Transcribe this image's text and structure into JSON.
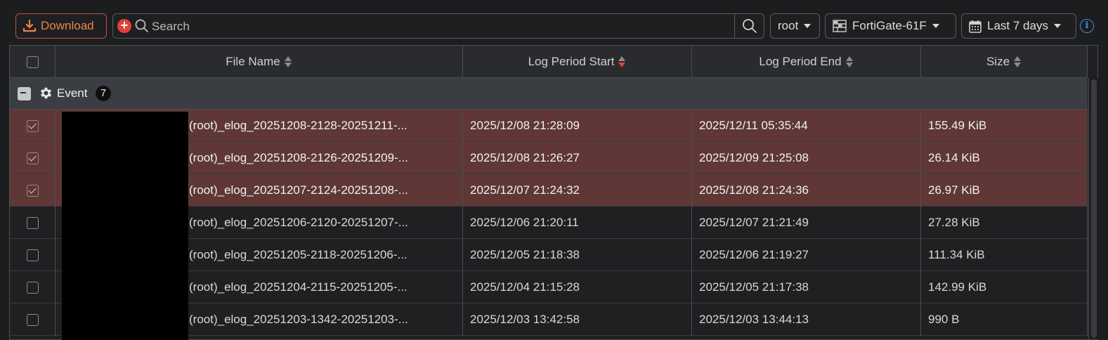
{
  "toolbar": {
    "download_label": "Download",
    "search_placeholder": "Search",
    "vdom": "root",
    "device": "FortiGate-61F",
    "time_range": "Last 7 days"
  },
  "columns": {
    "file_name": "File Name",
    "start": "Log Period Start",
    "end": "Log Period End",
    "size": "Size"
  },
  "group": {
    "name": "Event",
    "count": "7"
  },
  "rows": [
    {
      "file": "(root)_elog_20251208-2128-20251211-...",
      "start": "2025/12/08 21:28:09",
      "end": "2025/12/11 05:35:44",
      "size": "155.49 KiB",
      "checked": true
    },
    {
      "file": "(root)_elog_20251208-2126-20251209-...",
      "start": "2025/12/08 21:26:27",
      "end": "2025/12/09 21:25:08",
      "size": "26.14 KiB",
      "checked": true
    },
    {
      "file": "(root)_elog_20251207-2124-20251208-...",
      "start": "2025/12/07 21:24:32",
      "end": "2025/12/08 21:24:36",
      "size": "26.97 KiB",
      "checked": true
    },
    {
      "file": "(root)_elog_20251206-2120-20251207-...",
      "start": "2025/12/06 21:20:11",
      "end": "2025/12/07 21:21:49",
      "size": "27.28 KiB",
      "checked": false
    },
    {
      "file": "(root)_elog_20251205-2118-20251206-...",
      "start": "2025/12/05 21:18:38",
      "end": "2025/12/06 21:19:27",
      "size": "111.34 KiB",
      "checked": false
    },
    {
      "file": "(root)_elog_20251204-2115-20251205-...",
      "start": "2025/12/04 21:15:28",
      "end": "2025/12/05 21:17:38",
      "size": "142.99 KiB",
      "checked": false
    },
    {
      "file": "(root)_elog_20251203-1342-20251203-...",
      "start": "2025/12/03 13:42:58",
      "end": "2025/12/03 13:44:13",
      "size": "990 B",
      "checked": false
    }
  ],
  "icons": {
    "download": "download-icon",
    "add": "plus-circle-icon",
    "search": "search-icon",
    "device": "firewall-icon",
    "calendar": "calendar-icon",
    "info": "info-icon",
    "group": "gear-icon"
  },
  "colors": {
    "accent": "#ec8347",
    "selected_row": "#5e3736",
    "sort_active": "#e0413b",
    "info": "#3f8ed8"
  }
}
